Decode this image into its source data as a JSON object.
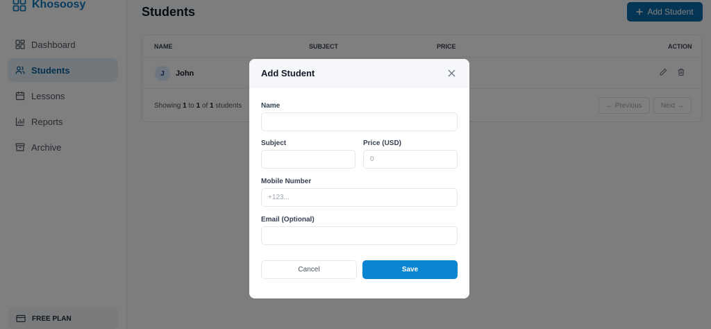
{
  "sidebar": {
    "brand": "Khosoosy",
    "items": [
      {
        "label": "Dashboard",
        "icon": "dashboard-icon"
      },
      {
        "label": "Students",
        "icon": "users-icon",
        "active": true
      },
      {
        "label": "Lessons",
        "icon": "calendar-icon"
      },
      {
        "label": "Reports",
        "icon": "bar-chart-icon"
      },
      {
        "label": "Archive",
        "icon": "archive-icon"
      }
    ],
    "plan": "FREE PLAN"
  },
  "main": {
    "title": "Students",
    "add_button": "Add Student",
    "table": {
      "headers": [
        "NAME",
        "SUBJECT",
        "PRICE",
        "ACTION"
      ],
      "rows": [
        {
          "initial": "J",
          "name": "John"
        }
      ]
    },
    "footer": {
      "showing": "Showing ",
      "from": "1",
      "to_word": " to ",
      "to": "1",
      "of_word": " of ",
      "total": "1",
      "suffix": " students"
    },
    "pagination": {
      "previous": "← Previous",
      "next": "Next →"
    }
  },
  "modal": {
    "title": "Add Student",
    "fields": {
      "name": {
        "label": "Name",
        "value": "",
        "placeholder": ""
      },
      "subject": {
        "label": "Subject",
        "value": "",
        "placeholder": ""
      },
      "price": {
        "label": "Price (USD)",
        "value": "",
        "placeholder": "0"
      },
      "mobile": {
        "label": "Mobile Number",
        "value": "",
        "placeholder": "+123..."
      },
      "email": {
        "label": "Email (Optional)",
        "value": "",
        "placeholder": ""
      }
    },
    "cancel": "Cancel",
    "save": "Save"
  },
  "colors": {
    "brand": "#0c79c0",
    "primary_button": "#0a85d1",
    "header_button": "#0a6aa8",
    "overlay": "rgba(0,0,0,0.5)"
  }
}
